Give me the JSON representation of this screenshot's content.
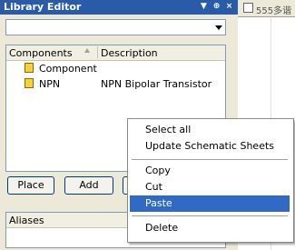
{
  "panel": {
    "title": "Library Editor",
    "buttons": {
      "dropdown": "▼",
      "pin": "⊕",
      "close": "×"
    }
  },
  "filter": {
    "value": ""
  },
  "components": {
    "headers": {
      "name": "Components",
      "description": "Description"
    },
    "rows": [
      {
        "name": "Component...",
        "description": ""
      },
      {
        "name": "NPN",
        "description": "NPN Bipolar Transistor"
      }
    ]
  },
  "actions": {
    "place": "Place",
    "add": "Add"
  },
  "aliases": {
    "header": "Aliases"
  },
  "document_tab": {
    "label": "555多谐"
  },
  "context_menu": {
    "items": [
      "Select all",
      "Update Schematic Sheets",
      "Copy",
      "Cut",
      "Paste",
      "Delete"
    ],
    "selected": "Paste"
  }
}
